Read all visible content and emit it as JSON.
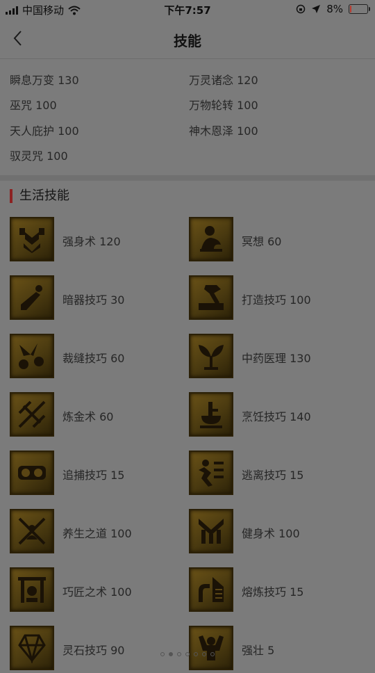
{
  "status": {
    "carrier": "中国移动",
    "time": "下午7:57",
    "battery": "8%",
    "battery_level": 0.08
  },
  "header": {
    "title": "技能"
  },
  "stats": [
    {
      "label": "瞬息万变 130"
    },
    {
      "label": "万灵诸念 120"
    },
    {
      "label": "巫咒 100"
    },
    {
      "label": "万物轮转 100"
    },
    {
      "label": "天人庇护 100"
    },
    {
      "label": "神木恩泽 100"
    },
    {
      "label": "驭灵咒 100"
    }
  ],
  "life_section": {
    "title": "生活技能"
  },
  "life_skills": [
    {
      "label": "强身术 120",
      "icon": "strength-icon"
    },
    {
      "label": "冥想 60",
      "icon": "meditation-icon"
    },
    {
      "label": "暗器技巧 30",
      "icon": "dart-icon"
    },
    {
      "label": "打造技巧 100",
      "icon": "hammer-icon"
    },
    {
      "label": "裁缝技巧 60",
      "icon": "scissors-icon"
    },
    {
      "label": "中药医理 130",
      "icon": "herb-icon"
    },
    {
      "label": "炼金术 60",
      "icon": "alchemy-icon"
    },
    {
      "label": "烹饪技巧 140",
      "icon": "cooking-icon"
    },
    {
      "label": "追捕技巧 15",
      "icon": "shackle-icon"
    },
    {
      "label": "逃离技巧 15",
      "icon": "escape-icon"
    },
    {
      "label": "养生之道 100",
      "icon": "health-icon"
    },
    {
      "label": "健身术 100",
      "icon": "fitness-icon"
    },
    {
      "label": "巧匠之术 100",
      "icon": "craftsman-icon"
    },
    {
      "label": "熔炼技巧 15",
      "icon": "smelting-icon"
    },
    {
      "label": "灵石技巧 90",
      "icon": "crystal-icon"
    },
    {
      "label": "强壮 5",
      "icon": "muscle-icon"
    }
  ],
  "pager": {
    "count": 7,
    "active": 1
  }
}
